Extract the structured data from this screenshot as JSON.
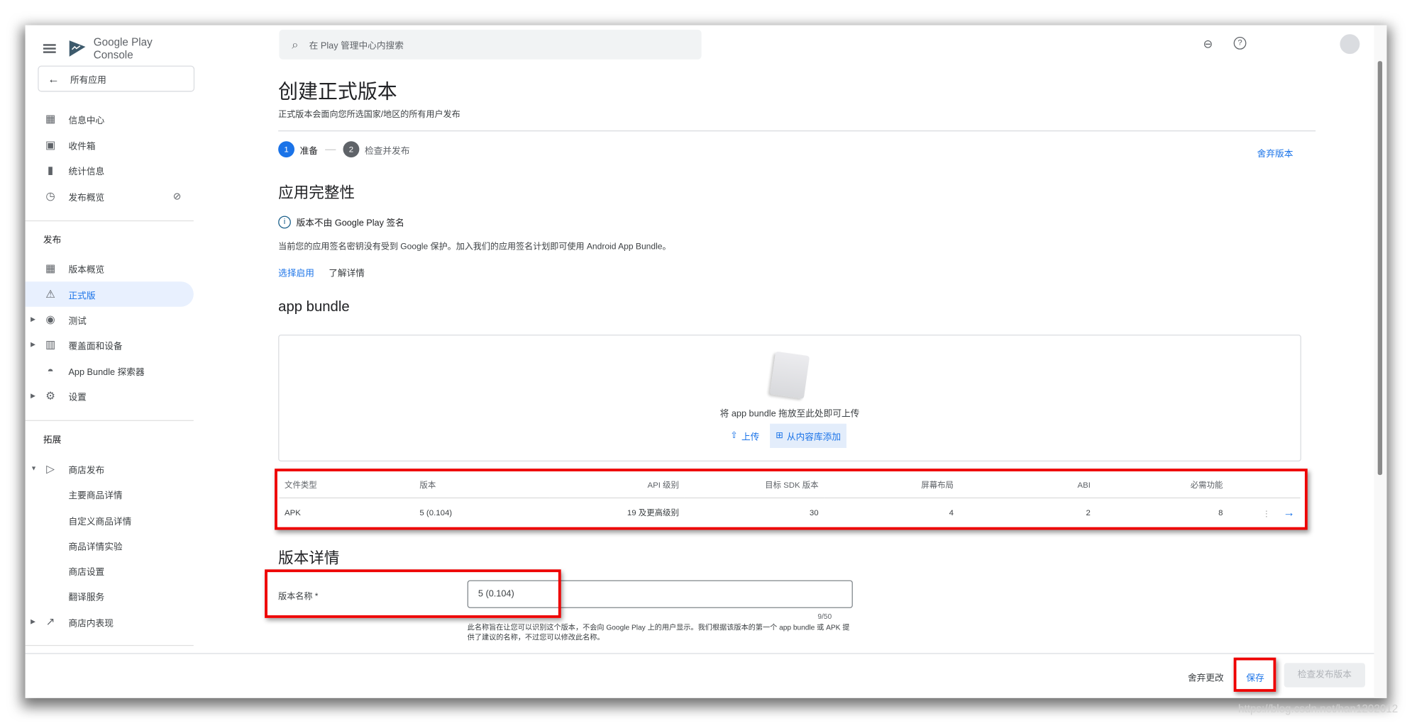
{
  "app": {
    "brand": "Google Play Console",
    "all_apps": "所有应用"
  },
  "sidebar": {
    "items": [
      {
        "label": "信息中心",
        "icon": "dashboard-icon"
      },
      {
        "label": "收件箱",
        "icon": "inbox-icon"
      },
      {
        "label": "统计信息",
        "icon": "bar-chart-icon"
      },
      {
        "label": "发布概览",
        "icon": "publish-history-icon"
      }
    ],
    "section_release": "发布",
    "release_items": [
      {
        "label": "版本概览",
        "icon": "widgets-icon"
      },
      {
        "label": "正式版",
        "icon": "production-icon"
      },
      {
        "label": "测试",
        "icon": "play-circle-icon"
      },
      {
        "label": "覆盖面和设备",
        "icon": "reach-icon"
      },
      {
        "label": "App Bundle 探索器",
        "icon": "android-icon"
      },
      {
        "label": "设置",
        "icon": "gear-icon"
      }
    ],
    "section_grow": "拓展",
    "grow_items": [
      {
        "label": "商店发布"
      },
      {
        "label": "主要商品详情"
      },
      {
        "label": "自定义商品详情"
      },
      {
        "label": "商品详情实验"
      },
      {
        "label": "商店设置"
      },
      {
        "label": "翻译服务"
      },
      {
        "label": "商店内表现"
      }
    ]
  },
  "topbar": {
    "search_placeholder": "在 Play 管理中心内搜索"
  },
  "page": {
    "title": "创建正式版本",
    "subtitle": "正式版本会面向您所选国家/地区的所有用户发布",
    "steps": [
      {
        "num": "1",
        "label": "准备"
      },
      {
        "num": "2",
        "label": "检查并发布"
      }
    ],
    "discard_release": "舍弃版本",
    "integrity": {
      "heading": "应用完整性",
      "notice": "版本不由 Google Play 签名",
      "desc": "当前您的应用签名密钥没有受到 Google 保护。加入我们的应用签名计划即可使用 Android App Bundle。",
      "opt_in": "选择启用",
      "learn_more": "了解详情"
    },
    "bundle": {
      "heading": "app bundle",
      "drop_text": "将 app bundle 拖放至此处即可上传",
      "upload": "上传",
      "add_from_library": "从内容库添加",
      "columns": [
        "文件类型",
        "版本",
        "API 级别",
        "目标 SDK 版本",
        "屏幕布局",
        "ABI",
        "必需功能"
      ],
      "rows": [
        [
          "APK",
          "5 (0.104)",
          "19 及更高级别",
          "30",
          "4",
          "2",
          "8"
        ]
      ]
    },
    "details": {
      "heading": "版本详情",
      "name_label": "版本名称 *",
      "name_value": "5 (0.104)",
      "counter": "9/50",
      "help": "此名称旨在让您可以识别这个版本，不会向 Google Play 上的用户显示。我们根据该版本的第一个 app bundle 或 APK 提供了建议的名称，不过您可以修改此名称。"
    }
  },
  "footer": {
    "discard_changes": "舍弃更改",
    "save": "保存",
    "review_release": "检查发布版本"
  },
  "watermark": "https://blog.csdn.net/han1202012",
  "colors": {
    "accent": "#1a73e8",
    "highlight": "#ff0000"
  }
}
